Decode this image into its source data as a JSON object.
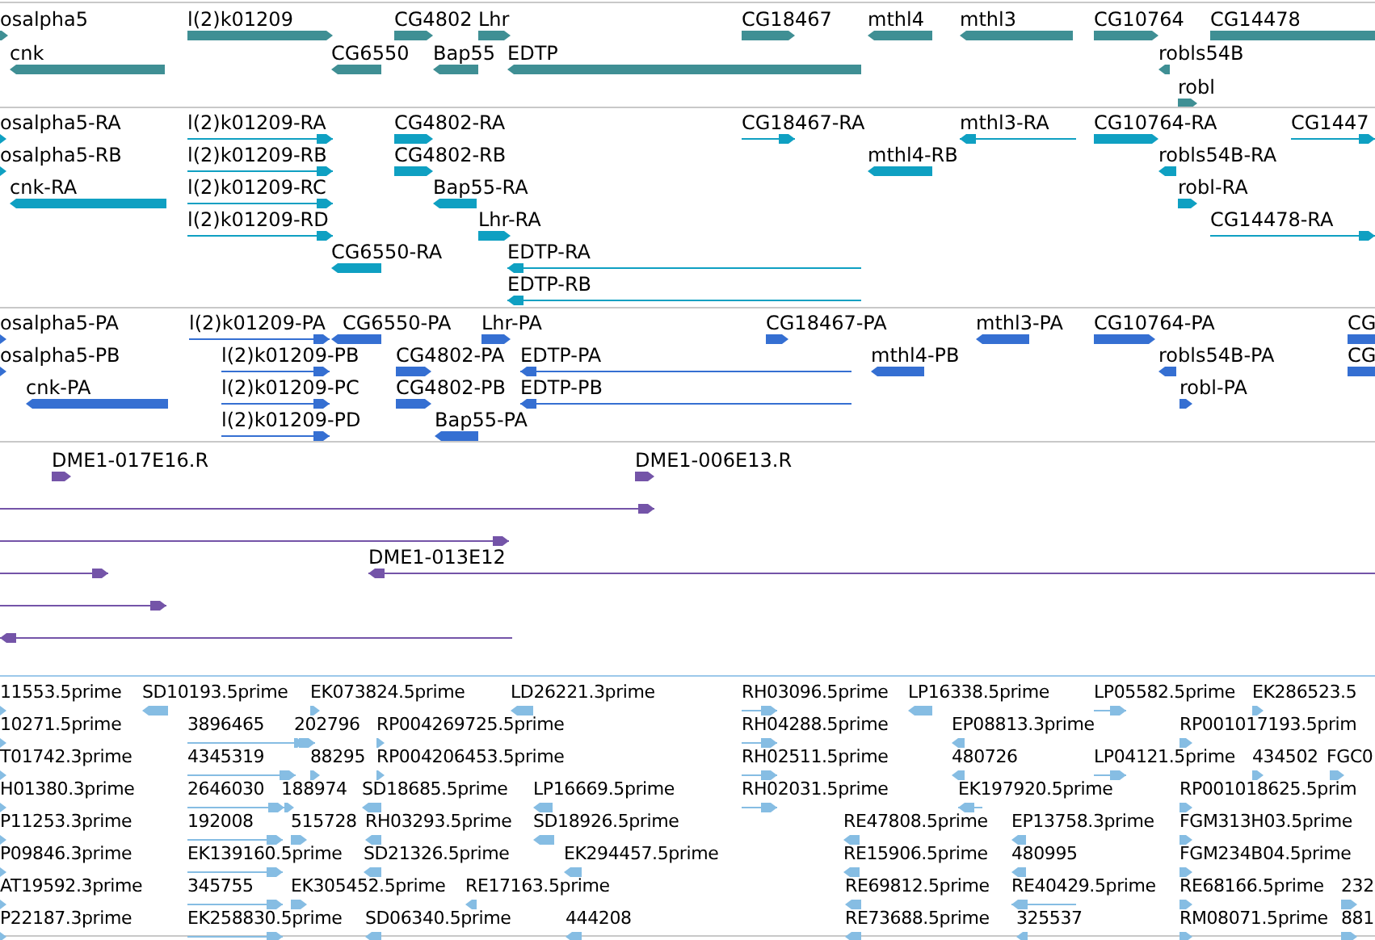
{
  "tracks": [
    {
      "features": [
        {
          "label": "osalpha5",
          "reverse": false
        },
        {
          "label": "l(2)k01209",
          "reverse": false
        },
        {
          "label": "CG4802",
          "reverse": false
        },
        {
          "label": "Lhr",
          "reverse": false
        },
        {
          "label": "CG18467",
          "reverse": false
        },
        {
          "label": "mthl4",
          "reverse": true
        },
        {
          "label": "mthl3",
          "reverse": true
        },
        {
          "label": "CG10764",
          "reverse": false
        },
        {
          "label": "CG14478"
        },
        {
          "label": "cnk",
          "reverse": true
        },
        {
          "label": "CG6550",
          "reverse": true
        },
        {
          "label": "Bap55",
          "reverse": true
        },
        {
          "label": "EDTP",
          "reverse": true
        },
        {
          "label": "robls54B",
          "reverse": true
        },
        {
          "label": "robl",
          "reverse": false
        }
      ]
    },
    {
      "features": [
        {
          "label": "osalpha5-RA",
          "reverse": false
        },
        {
          "label": "l(2)k01209-RA",
          "reverse": false
        },
        {
          "label": "CG4802-RA",
          "reverse": false
        },
        {
          "label": "CG18467-RA",
          "reverse": false
        },
        {
          "label": "mthl3-RA",
          "reverse": true
        },
        {
          "label": "CG10764-RA",
          "reverse": false
        },
        {
          "label": "CG1447",
          "reverse": false
        },
        {
          "label": "osalpha5-RB",
          "reverse": false
        },
        {
          "label": "l(2)k01209-RB",
          "reverse": false
        },
        {
          "label": "CG4802-RB",
          "reverse": false
        },
        {
          "label": "mthl4-RB",
          "reverse": true
        },
        {
          "label": "robls54B-RA",
          "reverse": true
        },
        {
          "label": "cnk-RA",
          "reverse": true
        },
        {
          "label": "l(2)k01209-RC",
          "reverse": false
        },
        {
          "label": "Bap55-RA",
          "reverse": true
        },
        {
          "label": "robl-RA",
          "reverse": false
        },
        {
          "label": "l(2)k01209-RD",
          "reverse": false
        },
        {
          "label": "Lhr-RA",
          "reverse": false
        },
        {
          "label": "CG14478-RA",
          "reverse": false
        },
        {
          "label": "CG6550-RA",
          "reverse": true
        },
        {
          "label": "EDTP-RA",
          "reverse": true
        },
        {
          "label": "EDTP-RB",
          "reverse": true
        }
      ]
    },
    {
      "features": [
        {
          "label": "osalpha5-PA",
          "reverse": false
        },
        {
          "label": "l(2)k01209-PA",
          "reverse": false
        },
        {
          "label": "CG6550-PA",
          "reverse": true
        },
        {
          "label": "Lhr-PA",
          "reverse": false
        },
        {
          "label": "CG18467-PA",
          "reverse": false
        },
        {
          "label": "mthl3-PA",
          "reverse": true
        },
        {
          "label": "CG10764-PA",
          "reverse": false
        },
        {
          "label": "CG"
        },
        {
          "label": "osalpha5-PB",
          "reverse": false
        },
        {
          "label": "l(2)k01209-PB",
          "reverse": false
        },
        {
          "label": "CG4802-PA",
          "reverse": false
        },
        {
          "label": "EDTP-PA",
          "reverse": true
        },
        {
          "label": "mthl4-PB",
          "reverse": true
        },
        {
          "label": "robls54B-PA",
          "reverse": true
        },
        {
          "label": "CG"
        },
        {
          "label": "cnk-PA",
          "reverse": true
        },
        {
          "label": "l(2)k01209-PC",
          "reverse": false
        },
        {
          "label": "CG4802-PB",
          "reverse": false
        },
        {
          "label": "EDTP-PB",
          "reverse": true
        },
        {
          "label": "robl-PA",
          "reverse": false
        },
        {
          "label": "l(2)k01209-PD",
          "reverse": false
        },
        {
          "label": "Bap55-PA",
          "reverse": true
        }
      ]
    },
    {
      "features": [
        {
          "label": "DME1-017E16.R",
          "reverse": false
        },
        {
          "label": "DME1-006E13.R",
          "reverse": false
        },
        {
          "reverse": false
        },
        {
          "reverse": false
        },
        {
          "reverse": false
        },
        {
          "label": "DME1-013E12",
          "reverse": true
        },
        {
          "reverse": false
        },
        {
          "reverse": true
        }
      ]
    },
    {
      "features": [
        {
          "label": "11553.5prime",
          "reverse": false
        },
        {
          "label": "SD10193.5prime",
          "reverse": true
        },
        {
          "label": "EK073824.5prime",
          "reverse": false
        },
        {
          "label": "LD26221.3prime",
          "reverse": true
        },
        {
          "label": "RH03096.5prime",
          "reverse": false
        },
        {
          "label": "LP16338.5prime",
          "reverse": true
        },
        {
          "label": "LP05582.5prime",
          "reverse": false
        },
        {
          "label": "EK286523.5",
          "reverse": false
        },
        {
          "label": "10271.5prime",
          "reverse": false
        },
        {
          "label": "3896465",
          "reverse": false
        },
        {
          "label": "202796",
          "reverse": false
        },
        {
          "label": "RP004269725.5prime",
          "reverse": false
        },
        {
          "label": "RH04288.5prime",
          "reverse": false
        },
        {
          "label": "EP08813.3prime",
          "reverse": true
        },
        {
          "label": "RP001017193.5prim",
          "reverse": false
        },
        {
          "label": "T01742.3prime",
          "reverse": false
        },
        {
          "label": "4345319",
          "reverse": false
        },
        {
          "label": "88295",
          "reverse": false
        },
        {
          "label": "RP004206453.5prime",
          "reverse": false
        },
        {
          "label": "RH02511.5prime",
          "reverse": false
        },
        {
          "label": "480726",
          "reverse": true
        },
        {
          "label": "LP04121.5prime",
          "reverse": false
        },
        {
          "label": "434502",
          "reverse": false
        },
        {
          "label": "FGC0",
          "reverse": false
        },
        {
          "label": "H01380.3prime",
          "reverse": false
        },
        {
          "label": "2646030",
          "reverse": false
        },
        {
          "label": "188974",
          "reverse": false
        },
        {
          "label": "SD18685.5prime",
          "reverse": true
        },
        {
          "label": "LP16669.5prime",
          "reverse": true
        },
        {
          "label": "RH02031.5prime",
          "reverse": false
        },
        {
          "label": "EK197920.5prime",
          "reverse": true
        },
        {
          "label": "RP001018625.5prim",
          "reverse": false
        },
        {
          "label": "P11253.3prime",
          "reverse": false
        },
        {
          "label": "192008",
          "reverse": false
        },
        {
          "label": "515728",
          "reverse": false
        },
        {
          "label": "RH03293.5prime",
          "reverse": true
        },
        {
          "label": "SD18926.5prime",
          "reverse": true
        },
        {
          "label": "RE47808.5prime",
          "reverse": true
        },
        {
          "label": "EP13758.3prime",
          "reverse": true
        },
        {
          "label": "FGM313H03.5prime",
          "reverse": false
        },
        {
          "label": "P09846.3prime",
          "reverse": false
        },
        {
          "label": "EK139160.5prime",
          "reverse": false
        },
        {
          "label": "SD21326.5prime",
          "reverse": true
        },
        {
          "label": "EK294457.5prime",
          "reverse": true
        },
        {
          "label": "RE15906.5prime",
          "reverse": true
        },
        {
          "label": "480995",
          "reverse": true
        },
        {
          "label": "FGM234B04.5prime",
          "reverse": false
        },
        {
          "label": "AT19592.3prime",
          "reverse": false
        },
        {
          "label": "345755",
          "reverse": false
        },
        {
          "label": "EK305452.5prime",
          "reverse": false
        },
        {
          "label": "RE17163.5prime",
          "reverse": true
        },
        {
          "label": "RE69812.5prime",
          "reverse": true
        },
        {
          "label": "RE40429.5prime",
          "reverse": true
        },
        {
          "label": "RE68166.5prime",
          "reverse": false
        },
        {
          "label": "232",
          "reverse": false
        },
        {
          "label": "P22187.3prime",
          "reverse": false
        },
        {
          "label": "EK258830.5prime",
          "reverse": false
        },
        {
          "label": "SD06340.5prime",
          "reverse": true
        },
        {
          "label": "444208",
          "reverse": true
        },
        {
          "label": "RE73688.5prime",
          "reverse": true
        },
        {
          "label": "325537",
          "reverse": true
        },
        {
          "label": "RM08071.5prime",
          "reverse": false
        },
        {
          "label": "881",
          "reverse": false
        }
      ]
    }
  ]
}
